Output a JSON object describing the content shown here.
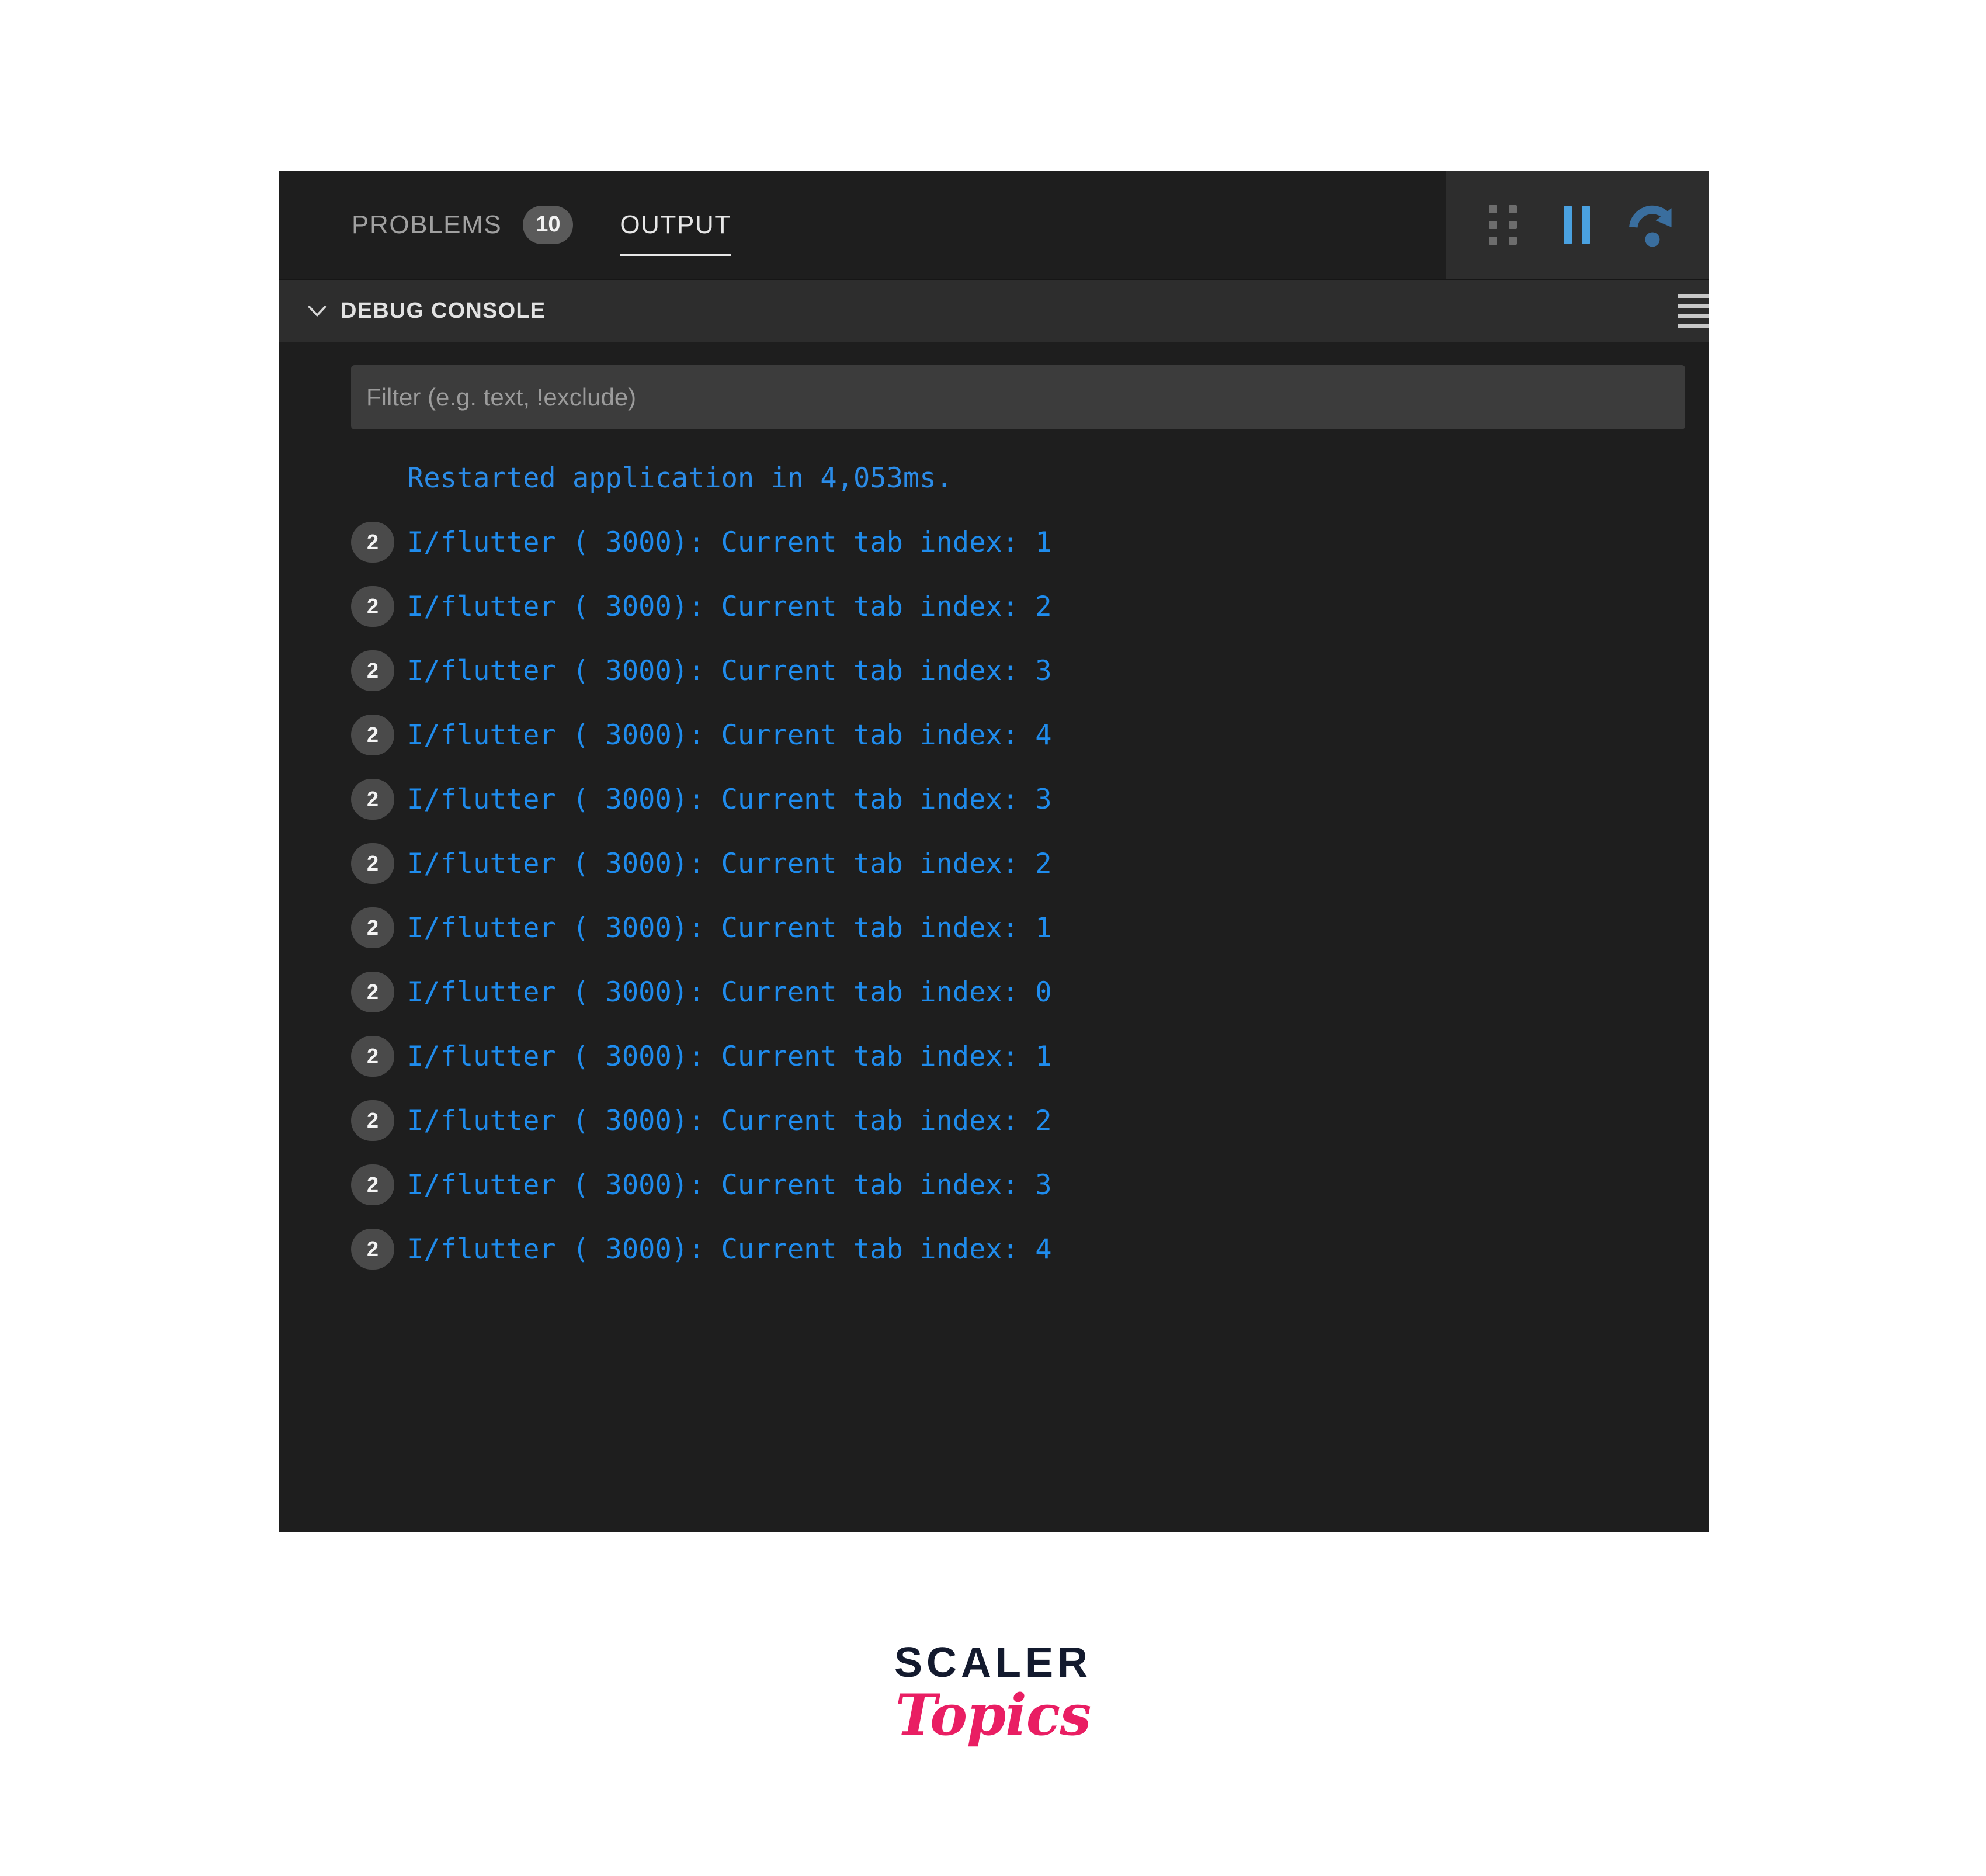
{
  "panel": {
    "tabs": [
      {
        "id": "problems",
        "label": "PROBLEMS",
        "badge": "10",
        "active": false
      },
      {
        "id": "output",
        "label": "OUTPUT",
        "badge": null,
        "active": true
      }
    ],
    "toolbar": {
      "grip_icon": "grip-dots-icon",
      "pause_icon": "pause-icon",
      "restart_icon": "restart-icon"
    },
    "console": {
      "title": "DEBUG CONSOLE",
      "chevron_icon": "chevron-down-icon",
      "menu_icon": "hamburger-menu-icon",
      "filter": {
        "value": "",
        "placeholder": "Filter (e.g. text, !exclude)"
      },
      "lines": [
        {
          "badge": null,
          "text": "Restarted application in 4,053ms."
        },
        {
          "badge": "2",
          "text": "I/flutter ( 3000): Current tab index: 1"
        },
        {
          "badge": "2",
          "text": "I/flutter ( 3000): Current tab index: 2"
        },
        {
          "badge": "2",
          "text": "I/flutter ( 3000): Current tab index: 3"
        },
        {
          "badge": "2",
          "text": "I/flutter ( 3000): Current tab index: 4"
        },
        {
          "badge": "2",
          "text": "I/flutter ( 3000): Current tab index: 3"
        },
        {
          "badge": "2",
          "text": "I/flutter ( 3000): Current tab index: 2"
        },
        {
          "badge": "2",
          "text": "I/flutter ( 3000): Current tab index: 1"
        },
        {
          "badge": "2",
          "text": "I/flutter ( 3000): Current tab index: 0"
        },
        {
          "badge": "2",
          "text": "I/flutter ( 3000): Current tab index: 1"
        },
        {
          "badge": "2",
          "text": "I/flutter ( 3000): Current tab index: 2"
        },
        {
          "badge": "2",
          "text": "I/flutter ( 3000): Current tab index: 3"
        },
        {
          "badge": "2",
          "text": "I/flutter ( 3000): Current tab index: 4"
        }
      ]
    }
  },
  "logo": {
    "primary": "SCALER",
    "secondary": "Topics"
  },
  "colors": {
    "panel_bg": "#1e1e1e",
    "header_bg": "#2d2d2d",
    "input_bg": "#3c3c3c",
    "log_text": "#1f8ced",
    "accent_blue": "#4aa1e0",
    "badge_bg": "#4a4a4a",
    "logo_primary": "#131a2e",
    "logo_secondary": "#e91e63"
  }
}
